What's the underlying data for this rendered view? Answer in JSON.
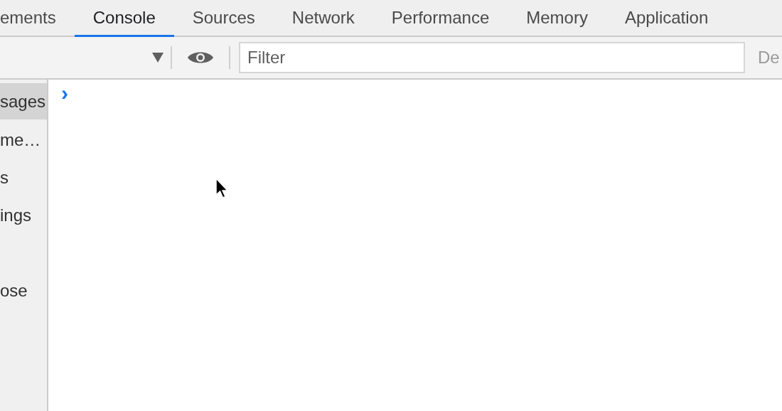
{
  "tabs": [
    {
      "label": "ements",
      "selected": false
    },
    {
      "label": "Console",
      "selected": true
    },
    {
      "label": "Sources",
      "selected": false
    },
    {
      "label": "Network",
      "selected": false
    },
    {
      "label": "Performance",
      "selected": false
    },
    {
      "label": "Memory",
      "selected": false
    },
    {
      "label": "Application",
      "selected": false
    }
  ],
  "toolbar": {
    "filter": {
      "placeholder": "Filter"
    },
    "levels_label": "De"
  },
  "sidebar": {
    "items": [
      {
        "kind": "entry",
        "label": "sages",
        "selected": true
      },
      {
        "kind": "entry",
        "label": "me…",
        "selected": false
      },
      {
        "kind": "entry",
        "label": "s",
        "selected": false
      },
      {
        "kind": "entry",
        "label": "ings",
        "selected": false
      },
      {
        "kind": "blank"
      },
      {
        "kind": "entry",
        "label": "ose",
        "selected": false
      }
    ]
  },
  "console": {
    "prompt": "›"
  }
}
